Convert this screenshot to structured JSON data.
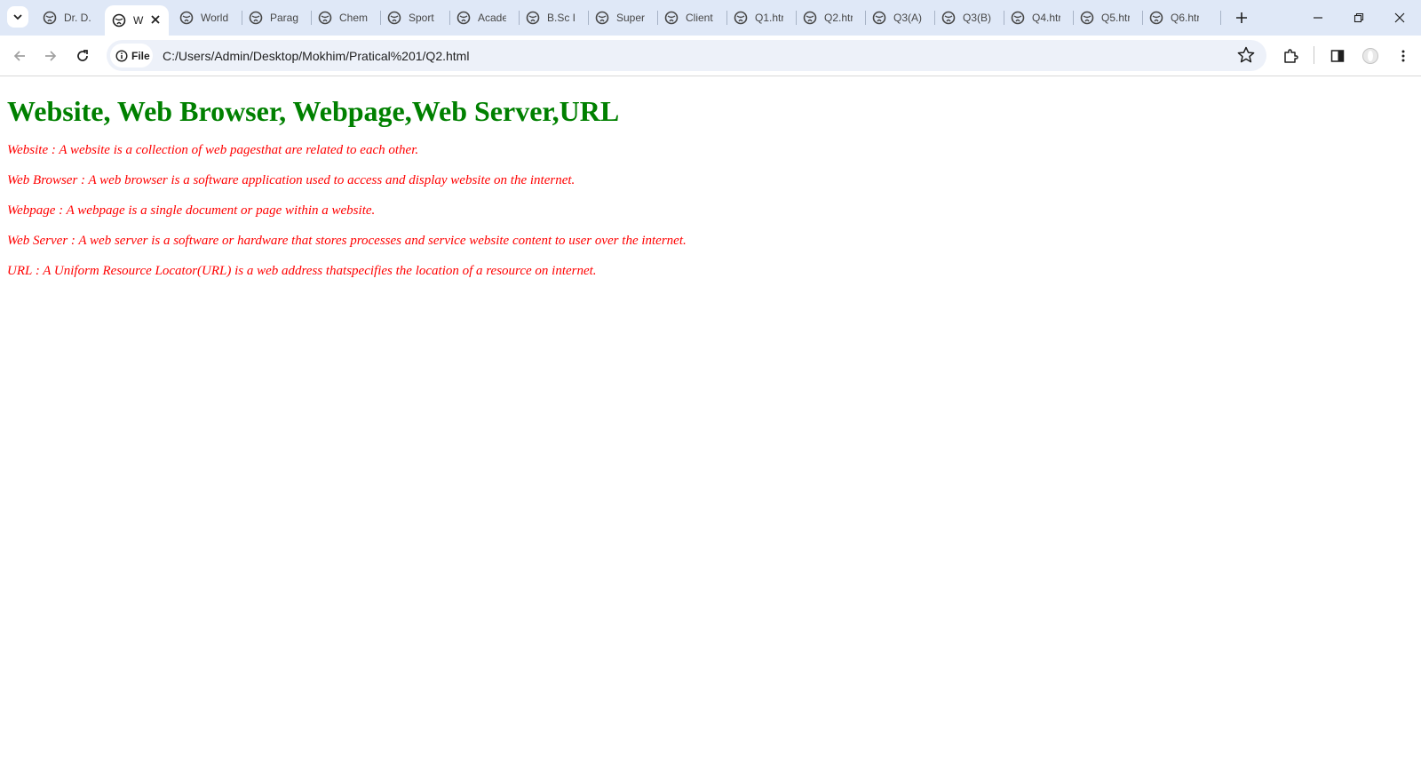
{
  "browser": {
    "tabs": [
      {
        "title": "Dr. D."
      },
      {
        "title": "W",
        "active": true
      },
      {
        "title": "World"
      },
      {
        "title": "Parag"
      },
      {
        "title": "Chem"
      },
      {
        "title": "Sport"
      },
      {
        "title": "Acade"
      },
      {
        "title": "B.Sc I"
      },
      {
        "title": "Super"
      },
      {
        "title": "Client"
      },
      {
        "title": "Q1.htr"
      },
      {
        "title": "Q2.htr"
      },
      {
        "title": "Q3(A)"
      },
      {
        "title": "Q3(B)"
      },
      {
        "title": "Q4.htr"
      },
      {
        "title": "Q5.htr"
      },
      {
        "title": "Q6.htr"
      }
    ],
    "omnibox": {
      "chip_label": "File",
      "url": "C:/Users/Admin/Desktop/Mokhim/Pratical%201/Q2.html"
    }
  },
  "page": {
    "heading": "Website, Web Browser, Webpage,Web Server,URL",
    "heading_color": "#008000",
    "text_color": "#ff0000",
    "definitions": [
      "Website : A website is a collection of web pagesthat are related to each other.",
      "Web Browser : A web browser is a software application used to access and display website on the internet.",
      "Webpage : A webpage is a single document or page within a website.",
      "Web Server : A web server is a software or hardware that stores processes and service website content to user over the internet.",
      "URL : A Uniform Resource Locator(URL) is a web address thatspecifies the location of a resource on internet."
    ]
  }
}
